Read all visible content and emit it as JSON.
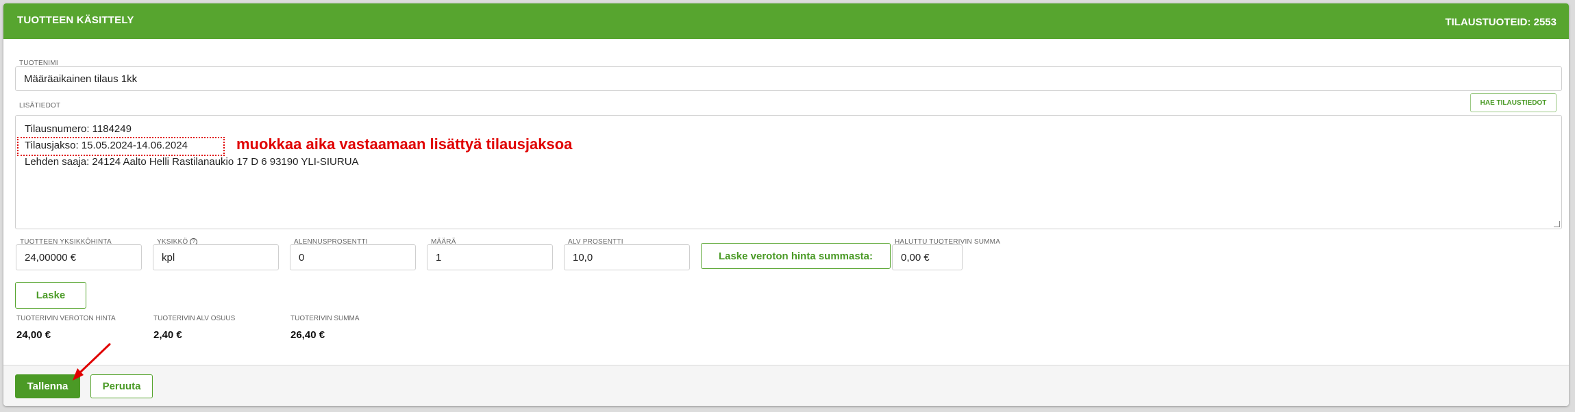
{
  "header": {
    "title": "TUOTTEEN KÄSITTELY",
    "order_products": "TILAUSTUOTEID: 2553"
  },
  "product": {
    "name_label": "TUOTENIMI",
    "name_value": "Määräaikainen tilaus 1kk"
  },
  "extra_info": {
    "label": "LISÄTIEDOT",
    "fetch_button": "HAE TILAUSTIEDOT",
    "lines": [
      "Tilausnumero: 1184249",
      "Tilausjakso: 15.05.2024-14.06.2024",
      "Lehden saaja: 24124 Aalto Helli Rastilanaukio 17 D 6 93190 YLI-SIURUA"
    ]
  },
  "annotation": {
    "text": "muokkaa aika vastaamaan lisättyä tilausjaksoa"
  },
  "pricing": {
    "unit_price_label": "TUOTTEEN YKSIKKÖHINTA",
    "unit_price_value": "24,00000 €",
    "unit_label": "YKSIKKÖ",
    "unit_value": "kpl",
    "discount_label": "ALENNUSPROSENTTI",
    "discount_value": "0",
    "quantity_label": "MÄÄRÄ",
    "quantity_value": "1",
    "vat_label": "ALV PROSENTTI",
    "vat_value": "10,0",
    "calc_net_button": "Laske veroton hinta summasta:",
    "desired_sum_label": "HALUTTU TUOTERIVIN SUMMA",
    "desired_sum_value": "0,00 €",
    "calculate_button": "Laske"
  },
  "summary": {
    "net_label": "TUOTERIVIN VEROTON HINTA",
    "net_value": "24,00 €",
    "vat_share_label": "TUOTERIVIN ALV OSUUS",
    "vat_share_value": "2,40 €",
    "total_label": "TUOTERIVIN SUMMA",
    "total_value": "26,40 €"
  },
  "footer": {
    "save_button": "Tallenna",
    "cancel_button": "Peruuta"
  },
  "colors": {
    "brand_green": "#57a52f",
    "annotation_red": "#e00000"
  }
}
